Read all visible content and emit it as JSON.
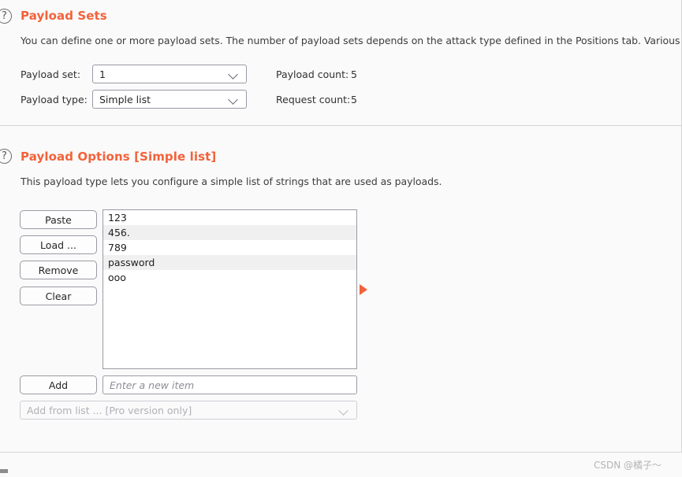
{
  "theme": {
    "accent": "#f2623a",
    "background": "#fafafa",
    "field_background": "#ffffff",
    "border": "#9a9aa4",
    "divider": "#d4d4d4",
    "text": "#303030",
    "muted_text": "#8d8d97",
    "row_alt": "#f0f0f0"
  },
  "payload_sets": {
    "help_icon": "question-mark-circle-icon",
    "title": "Payload Sets",
    "description": "You can define one or more payload sets. The number of payload sets depends on the attack type defined in the Positions tab. Various pay",
    "payload_set": {
      "label": "Payload set:",
      "value": "1",
      "chevron_icon": "chevron-down-icon"
    },
    "payload_type": {
      "label": "Payload type:",
      "value": "Simple list",
      "chevron_icon": "chevron-down-icon"
    },
    "payload_count": {
      "label": "Payload count:",
      "value": "5"
    },
    "request_count": {
      "label": "Request count:",
      "value": "5"
    }
  },
  "payload_options": {
    "help_icon": "question-mark-circle-icon",
    "title": "Payload Options [Simple list]",
    "description": "This payload type lets you configure a simple list of strings that are used as payloads.",
    "buttons": [
      {
        "label": "Paste",
        "name": "paste-button"
      },
      {
        "label": "Load ...",
        "name": "load-button"
      },
      {
        "label": "Remove",
        "name": "remove-button"
      },
      {
        "label": "Clear",
        "name": "clear-button"
      }
    ],
    "list_items": [
      "123",
      "456.",
      "789",
      "password",
      "ooo"
    ],
    "add_button": "Add",
    "new_item_placeholder": "Enter a new item",
    "new_item_value": "",
    "add_from_list": {
      "value": "Add from list ... [Pro version only]",
      "chevron_icon": "chevron-down-icon",
      "disabled": true
    },
    "marker_icon": "play-triangle-marker-icon"
  },
  "watermark": "CSDN @橘子～"
}
